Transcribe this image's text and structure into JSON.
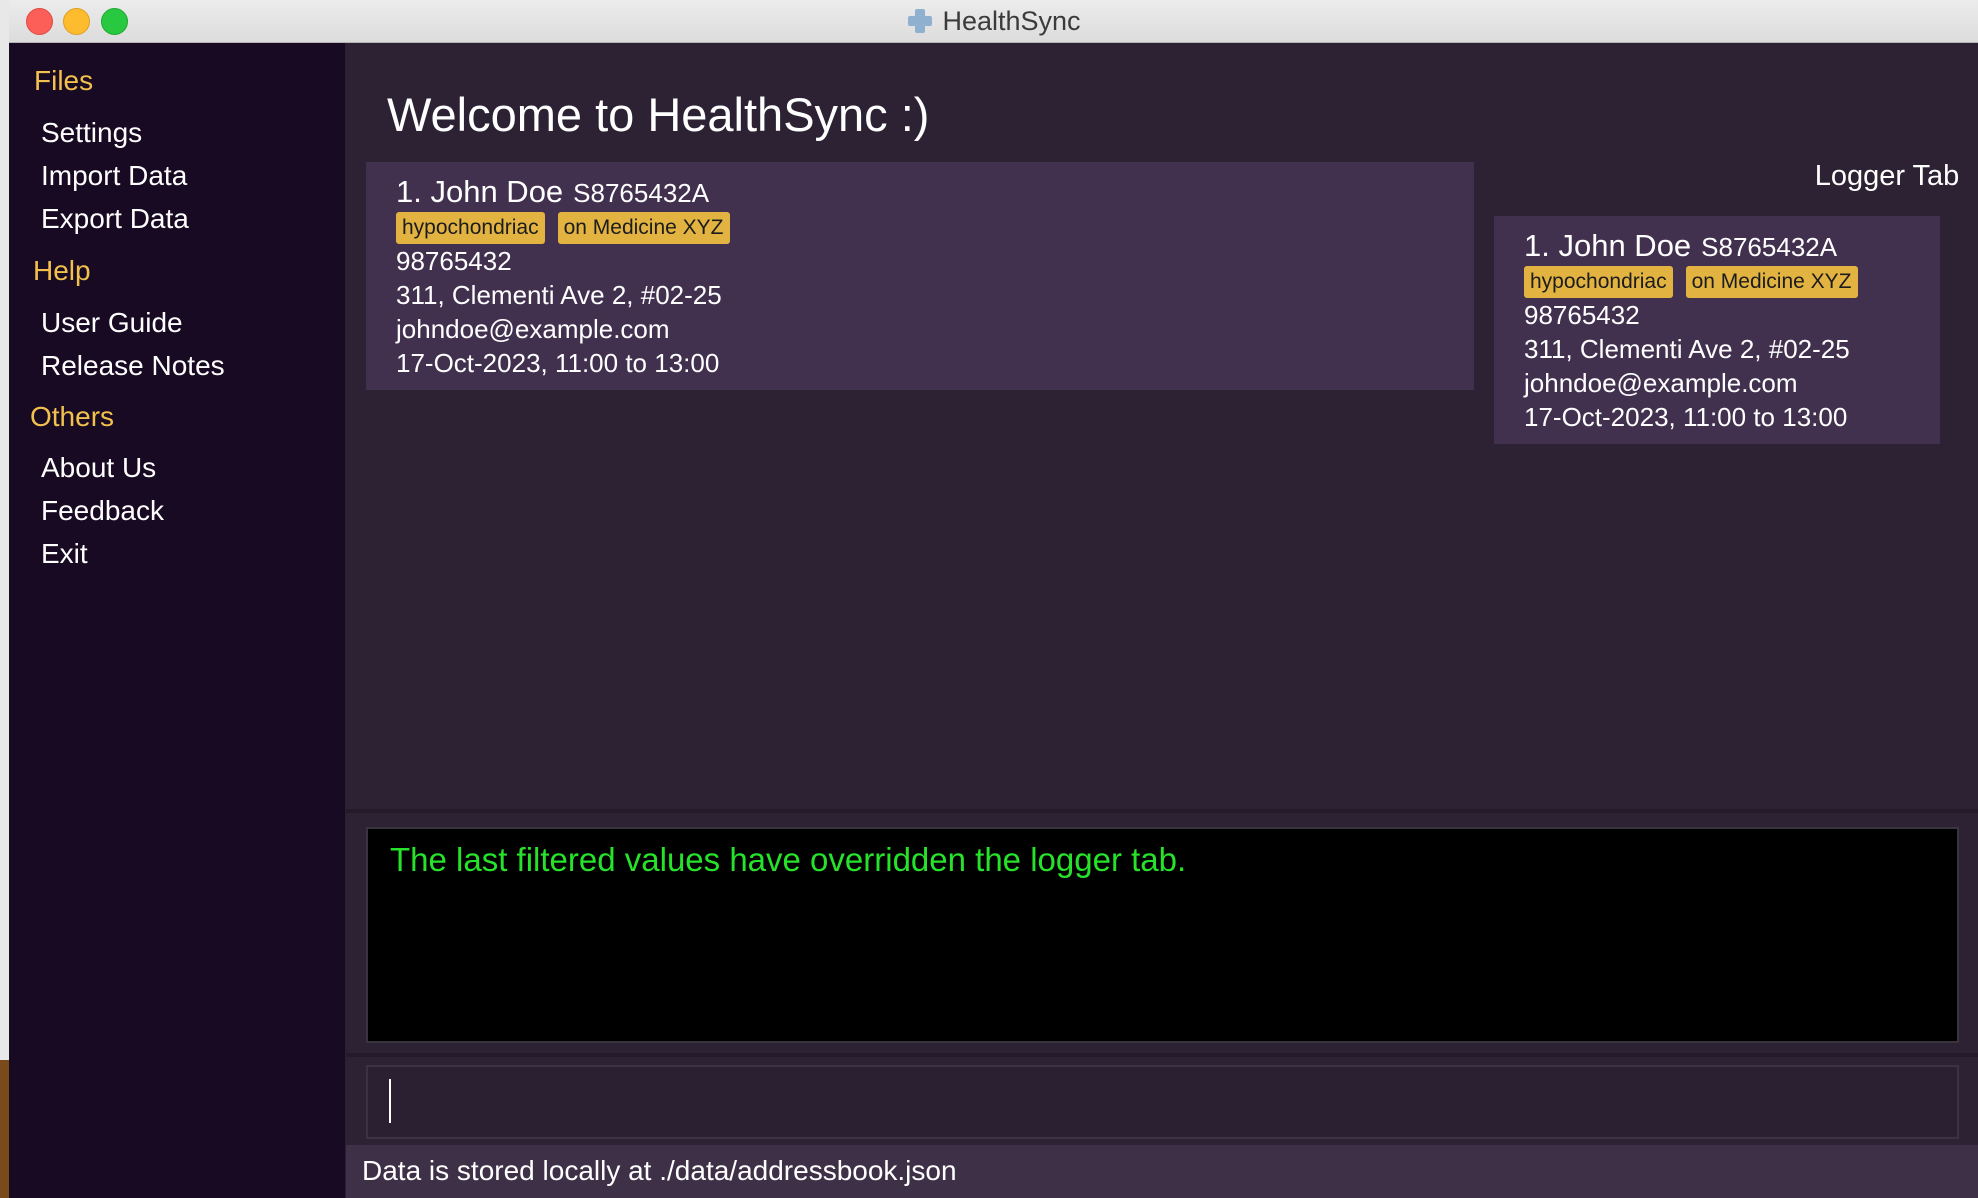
{
  "window": {
    "title": "HealthSync"
  },
  "sidebar": {
    "sections": [
      {
        "header": "Files",
        "items": [
          "Settings",
          "Import Data",
          "Export Data"
        ]
      },
      {
        "header": "Help",
        "items": [
          "User Guide",
          "Release Notes"
        ]
      },
      {
        "header": "Others",
        "items": [
          "About Us",
          "Feedback",
          "Exit"
        ]
      }
    ]
  },
  "main": {
    "welcome": "Welcome to HealthSync :)",
    "patient_card": {
      "index_name": "1.  John Doe",
      "nric": "S8765432A",
      "tags": [
        "hypochondriac",
        "on Medicine XYZ"
      ],
      "phone": "98765432",
      "address": "311, Clementi Ave 2, #02-25",
      "email": "johndoe@example.com",
      "appointment": "17-Oct-2023, 11:00 to 13:00"
    }
  },
  "logger": {
    "title": "Logger Tab",
    "card": {
      "index_name": "1.  John Doe",
      "nric": "S8765432A",
      "tags": [
        "hypochondriac",
        "on Medicine XYZ"
      ],
      "phone": "98765432",
      "address": "311, Clementi Ave 2, #02-25",
      "email": "johndoe@example.com",
      "appointment": "17-Oct-2023, 11:00 to 13:00"
    }
  },
  "result": {
    "message": "The last filtered values have overridden the logger tab."
  },
  "command": {
    "value": ""
  },
  "status": {
    "text": "Data is stored locally at ./data/addressbook.json"
  },
  "colors": {
    "accent": "#f2c04c",
    "tag": "#e3b342",
    "result_text": "#27e22a",
    "sidebar_bg": "#180a22",
    "card_bg": "#41314f"
  },
  "icons": {
    "app": "health-cross-icon"
  }
}
